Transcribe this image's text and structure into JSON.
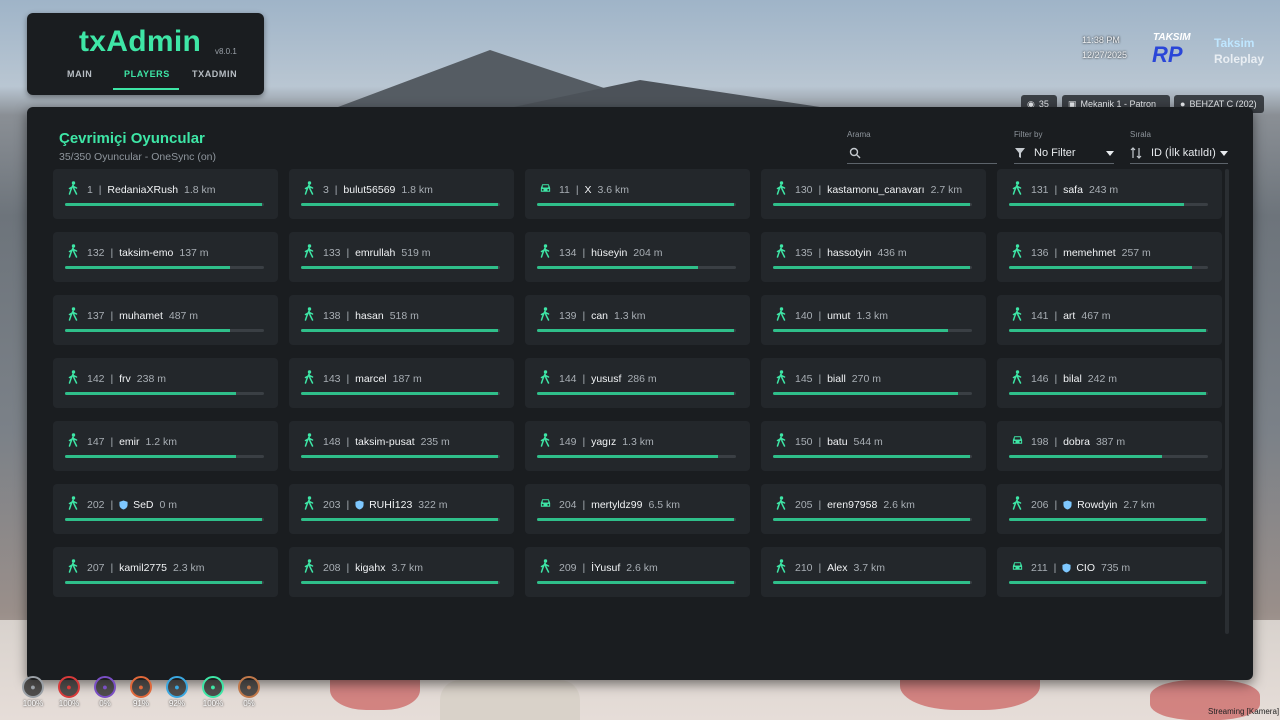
{
  "txadmin": {
    "logo": "txAdmin",
    "version": "v8.0.1",
    "tabs": [
      "MAIN",
      "PLAYERS",
      "TXADMIN"
    ],
    "active_tab": "PLAYERS"
  },
  "hud": {
    "time": "11:38 PM",
    "date": "12/27/2025",
    "server_logo_text": "TAKSIM RP",
    "server_name_1": "Taksim",
    "server_name_2": "Roleplay",
    "chips": [
      {
        "icon": "signal-icon",
        "text": "35"
      },
      {
        "icon": "job-icon",
        "text": "Mekanik 1 - Patron"
      },
      {
        "icon": "user-icon",
        "text": "BEHZAT C (202)"
      }
    ]
  },
  "panel": {
    "title": "Çevrimiçi Oyuncular",
    "subtitle": "35/350 Oyuncular - OneSync (on)",
    "search_label": "Arama",
    "search_value": "",
    "filter_label": "Filter by",
    "filter_value": "No Filter",
    "sort_label": "Sırala",
    "sort_value": "ID (İlk katıldı)"
  },
  "players": [
    {
      "id": "1",
      "name": "RedaniaXRush",
      "dist": "1.8 km",
      "icon": "walk-icon",
      "health": 0.99,
      "shield": false
    },
    {
      "id": "3",
      "name": "bulut56569",
      "dist": "1.8 km",
      "icon": "walk-icon",
      "health": 0.99,
      "shield": false
    },
    {
      "id": "11",
      "name": "X",
      "dist": "3.6 km",
      "icon": "car-icon",
      "health": 0.99,
      "shield": false
    },
    {
      "id": "130",
      "name": "kastamonu_canavarı",
      "dist": "2.7 km",
      "icon": "walk-icon",
      "health": 0.99,
      "shield": false
    },
    {
      "id": "131",
      "name": "safa",
      "dist": "243 m",
      "icon": "walk-icon",
      "health": 0.88,
      "shield": false
    },
    {
      "id": "132",
      "name": "taksim-emo",
      "dist": "137 m",
      "icon": "walk-icon",
      "health": 0.83,
      "shield": false
    },
    {
      "id": "133",
      "name": "emrullah",
      "dist": "519 m",
      "icon": "walk-icon",
      "health": 0.99,
      "shield": false
    },
    {
      "id": "134",
      "name": "hüseyin",
      "dist": "204 m",
      "icon": "walk-icon",
      "health": 0.81,
      "shield": false
    },
    {
      "id": "135",
      "name": "hassotyin",
      "dist": "436 m",
      "icon": "walk-icon",
      "health": 0.99,
      "shield": false
    },
    {
      "id": "136",
      "name": "memehmet",
      "dist": "257 m",
      "icon": "walk-icon",
      "health": 0.92,
      "shield": false
    },
    {
      "id": "137",
      "name": "muhamet",
      "dist": "487 m",
      "icon": "walk-icon",
      "health": 0.83,
      "shield": false
    },
    {
      "id": "138",
      "name": "hasan",
      "dist": "518 m",
      "icon": "walk-icon",
      "health": 0.99,
      "shield": false
    },
    {
      "id": "139",
      "name": "can",
      "dist": "1.3 km",
      "icon": "walk-icon",
      "health": 0.99,
      "shield": false
    },
    {
      "id": "140",
      "name": "umut",
      "dist": "1.3 km",
      "icon": "walk-icon",
      "health": 0.88,
      "shield": false
    },
    {
      "id": "141",
      "name": "art",
      "dist": "467 m",
      "icon": "walk-icon",
      "health": 0.99,
      "shield": false
    },
    {
      "id": "142",
      "name": "frv",
      "dist": "238 m",
      "icon": "walk-icon",
      "health": 0.86,
      "shield": false
    },
    {
      "id": "143",
      "name": "marcel",
      "dist": "187 m",
      "icon": "walk-icon",
      "health": 0.99,
      "shield": false
    },
    {
      "id": "144",
      "name": "yususf",
      "dist": "286 m",
      "icon": "walk-icon",
      "health": 0.99,
      "shield": false
    },
    {
      "id": "145",
      "name": "biall",
      "dist": "270 m",
      "icon": "walk-icon",
      "health": 0.93,
      "shield": false
    },
    {
      "id": "146",
      "name": "bilal",
      "dist": "242 m",
      "icon": "walk-icon",
      "health": 0.99,
      "shield": false
    },
    {
      "id": "147",
      "name": "emir",
      "dist": "1.2 km",
      "icon": "walk-icon",
      "health": 0.86,
      "shield": false
    },
    {
      "id": "148",
      "name": "taksim-pusat",
      "dist": "235 m",
      "icon": "walk-icon",
      "health": 0.99,
      "shield": false
    },
    {
      "id": "149",
      "name": "yagız",
      "dist": "1.3 km",
      "icon": "walk-icon",
      "health": 0.91,
      "shield": false
    },
    {
      "id": "150",
      "name": "batu",
      "dist": "544 m",
      "icon": "walk-icon",
      "health": 0.99,
      "shield": false
    },
    {
      "id": "198",
      "name": "dobra",
      "dist": "387 m",
      "icon": "car-icon",
      "health": 0.77,
      "shield": false
    },
    {
      "id": "202",
      "name": "SeD",
      "dist": "0 m",
      "icon": "walk-icon",
      "health": 0.99,
      "shield": true
    },
    {
      "id": "203",
      "name": "RUHİ123",
      "dist": "322 m",
      "icon": "walk-icon",
      "health": 0.99,
      "shield": true
    },
    {
      "id": "204",
      "name": "mertyldz99",
      "dist": "6.5 km",
      "icon": "car-icon",
      "health": 0.99,
      "shield": false
    },
    {
      "id": "205",
      "name": "eren97958",
      "dist": "2.6 km",
      "icon": "walk-icon",
      "health": 0.99,
      "shield": false
    },
    {
      "id": "206",
      "name": "Rowdyin",
      "dist": "2.7 km",
      "icon": "walk-icon",
      "health": 0.99,
      "shield": true
    },
    {
      "id": "207",
      "name": "kamil2775",
      "dist": "2.3 km",
      "icon": "walk-icon",
      "health": 0.99,
      "shield": false
    },
    {
      "id": "208",
      "name": "kigahx",
      "dist": "3.7 km",
      "icon": "walk-icon",
      "health": 0.99,
      "shield": false
    },
    {
      "id": "209",
      "name": "İYusuf",
      "dist": "2.6 km",
      "icon": "walk-icon",
      "health": 0.99,
      "shield": false
    },
    {
      "id": "210",
      "name": "Alex",
      "dist": "3.7 km",
      "icon": "walk-icon",
      "health": 0.99,
      "shield": false
    },
    {
      "id": "211",
      "name": "CIO",
      "dist": "735 m",
      "icon": "car-icon",
      "health": 0.99,
      "shield": true
    }
  ],
  "status": [
    {
      "name": "voice-icon",
      "value": "100%",
      "color": "#9aa0a6"
    },
    {
      "name": "health-icon",
      "value": "100%",
      "color": "#d83a3a"
    },
    {
      "name": "armor-icon",
      "value": "0%",
      "color": "#7a4fc4"
    },
    {
      "name": "hunger-icon",
      "value": "91%",
      "color": "#e0683a"
    },
    {
      "name": "thirst-icon",
      "value": "92%",
      "color": "#3aa7e0"
    },
    {
      "name": "stamina-icon",
      "value": "100%",
      "color": "#3ee6a6"
    },
    {
      "name": "stress-icon",
      "value": "0%",
      "color": "#c0784a"
    }
  ],
  "corner_note": "Streaming [Kamera]",
  "colors": {
    "accent": "#3ee6a6",
    "panel_bg": "#1a1d20",
    "card_bg": "#23272b"
  }
}
